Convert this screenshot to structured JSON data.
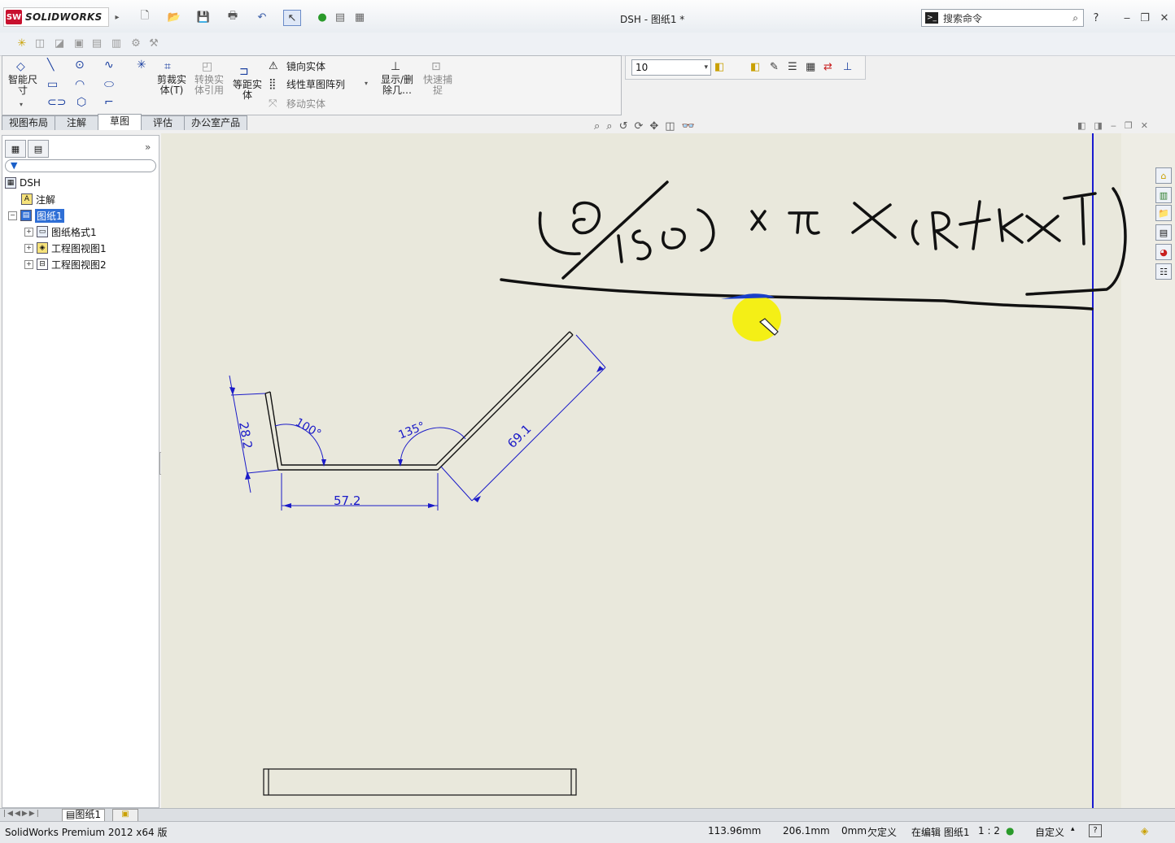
{
  "app": {
    "brand": "SOLIDWORKS",
    "brand_badge": "SW",
    "doc_title": "DSH - 图纸1 *",
    "search_placeholder": "搜索命令",
    "help": "?"
  },
  "command_manager": {
    "smart_dim": "智能尺\n寸",
    "trim": "剪裁实\n体(T)",
    "convert": "转换实\n体引用",
    "offset": "等距实\n体",
    "mirror": "镜向实体",
    "linear_pattern": "线性草图阵列",
    "move": "移动实体",
    "show_delete": "显示/删\n除几…",
    "quick_snap": "快速捕\n捉"
  },
  "layer_combo_value": "10",
  "tabs": [
    "视图布局",
    "注解",
    "草图",
    "评估",
    "办公室产品"
  ],
  "active_tab": "草图",
  "tree": {
    "root": "DSH",
    "annotations": "注解",
    "sheet": "图纸1",
    "children": [
      "图纸格式1",
      "工程图视图1",
      "工程图视图2"
    ]
  },
  "drawing": {
    "dim_height": "28.2",
    "dim_bottom": "57.2",
    "dim_slant": "69.1",
    "angle_left": "100°",
    "angle_right": "135°"
  },
  "sheet_tab": "图纸1",
  "status": {
    "product": "SolidWorks Premium 2012 x64 版",
    "x": "113.96mm",
    "y": "206.1mm",
    "z": "0mm",
    "state": "欠定义",
    "editing": "在编辑 图纸1",
    "scale": "1 : 2",
    "custom": "自定义"
  },
  "colors": {
    "dimension": "#1b1bc8",
    "canvas": "#e9e8dc",
    "cursor_highlight": "#f5f000",
    "selection": "#2f6fd6"
  }
}
